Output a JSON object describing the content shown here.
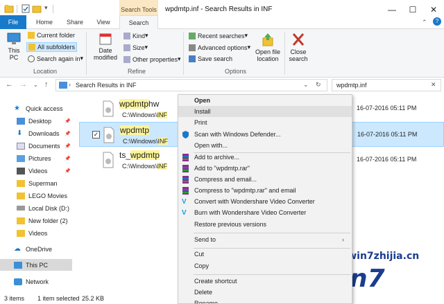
{
  "window": {
    "context_tab_title": "Search Tools",
    "title": "wpdmtp.inf - Search Results in INF"
  },
  "ribbon_tabs": {
    "file": "File",
    "home": "Home",
    "share": "Share",
    "view": "View",
    "search": "Search"
  },
  "ribbon": {
    "this_pc": "This PC",
    "current_folder": "Current folder",
    "all_subfolders": "All subfolders",
    "search_again_in": "Search again in",
    "location_label": "Location",
    "date_modified": "Date modified",
    "kind": "Kind",
    "size": "Size",
    "other_properties": "Other properties",
    "refine_label": "Refine",
    "recent_searches": "Recent searches",
    "advanced_options": "Advanced options",
    "save_search": "Save search",
    "options_label": "Options",
    "open_file_location": "Open file location",
    "close_search": "Close search"
  },
  "address": {
    "path": "Search Results in INF",
    "search_query": "wpdmtp.inf"
  },
  "sidebar": {
    "items": [
      {
        "label": "Quick access",
        "icon": "star-icon"
      },
      {
        "label": "Desktop",
        "icon": "desktop-icon"
      },
      {
        "label": "Downloads",
        "icon": "download-icon"
      },
      {
        "label": "Documents",
        "icon": "documents-icon"
      },
      {
        "label": "Pictures",
        "icon": "pictures-icon"
      },
      {
        "label": "Videos",
        "icon": "videos-icon"
      },
      {
        "label": "Superman",
        "icon": "folder-icon"
      },
      {
        "label": "LEGO Movies",
        "icon": "folder-icon"
      },
      {
        "label": "Local Disk (D:)",
        "icon": "drive-icon"
      },
      {
        "label": "New folder (2)",
        "icon": "folder-icon"
      },
      {
        "label": "Videos",
        "icon": "folder-icon"
      },
      {
        "label": "OneDrive",
        "icon": "cloud-icon"
      },
      {
        "label": "This PC",
        "icon": "pc-icon"
      },
      {
        "label": "Network",
        "icon": "network-icon"
      }
    ]
  },
  "files": [
    {
      "name_hl": "wpdmtp",
      "name_rest": "hw",
      "name_pre": "",
      "path_pre": "C:\\Windows\\",
      "path_hl": "INF",
      "date": "16-07-2016 05:11 PM"
    },
    {
      "name_hl": "wpdmtp",
      "name_rest": "",
      "name_pre": "",
      "path_pre": "C:\\Windows\\",
      "path_hl": "INF",
      "date": "16-07-2016 05:11 PM"
    },
    {
      "name_hl": "wpdmtp",
      "name_rest": "",
      "name_pre": "ts_",
      "path_pre": "C:\\Windows\\",
      "path_hl": "INF",
      "date": "16-07-2016 05:11 PM"
    }
  ],
  "context_menu": {
    "open": "Open",
    "install": "Install",
    "print": "Print",
    "scan": "Scan with Windows Defender...",
    "open_with": "Open with...",
    "add_archive": "Add to archive...",
    "add_rar": "Add to \"wpdmtp.rar\"",
    "compress_email": "Compress and email...",
    "compress_rar_email": "Compress to \"wpdmtp.rar\" and email",
    "convert_ws": "Convert with Wondershare Video Converter",
    "burn_ws": "Burn with Wondershare Video Converter",
    "restore": "Restore previous versions",
    "send_to": "Send to",
    "cut": "Cut",
    "copy": "Copy",
    "create_shortcut": "Create shortcut",
    "delete": "Delete",
    "rename": "Rename"
  },
  "status": {
    "items": "3 items",
    "selected": "1 item selected",
    "size": "25.2 KB"
  },
  "watermark": {
    "url": "www.win7zhijia.cn",
    "logo": "Win7"
  },
  "colors": {
    "file_tab": "#1979ca",
    "selection": "#cce8ff",
    "highlight": "#fcf49b",
    "context_tab": "#fbe7c4"
  }
}
